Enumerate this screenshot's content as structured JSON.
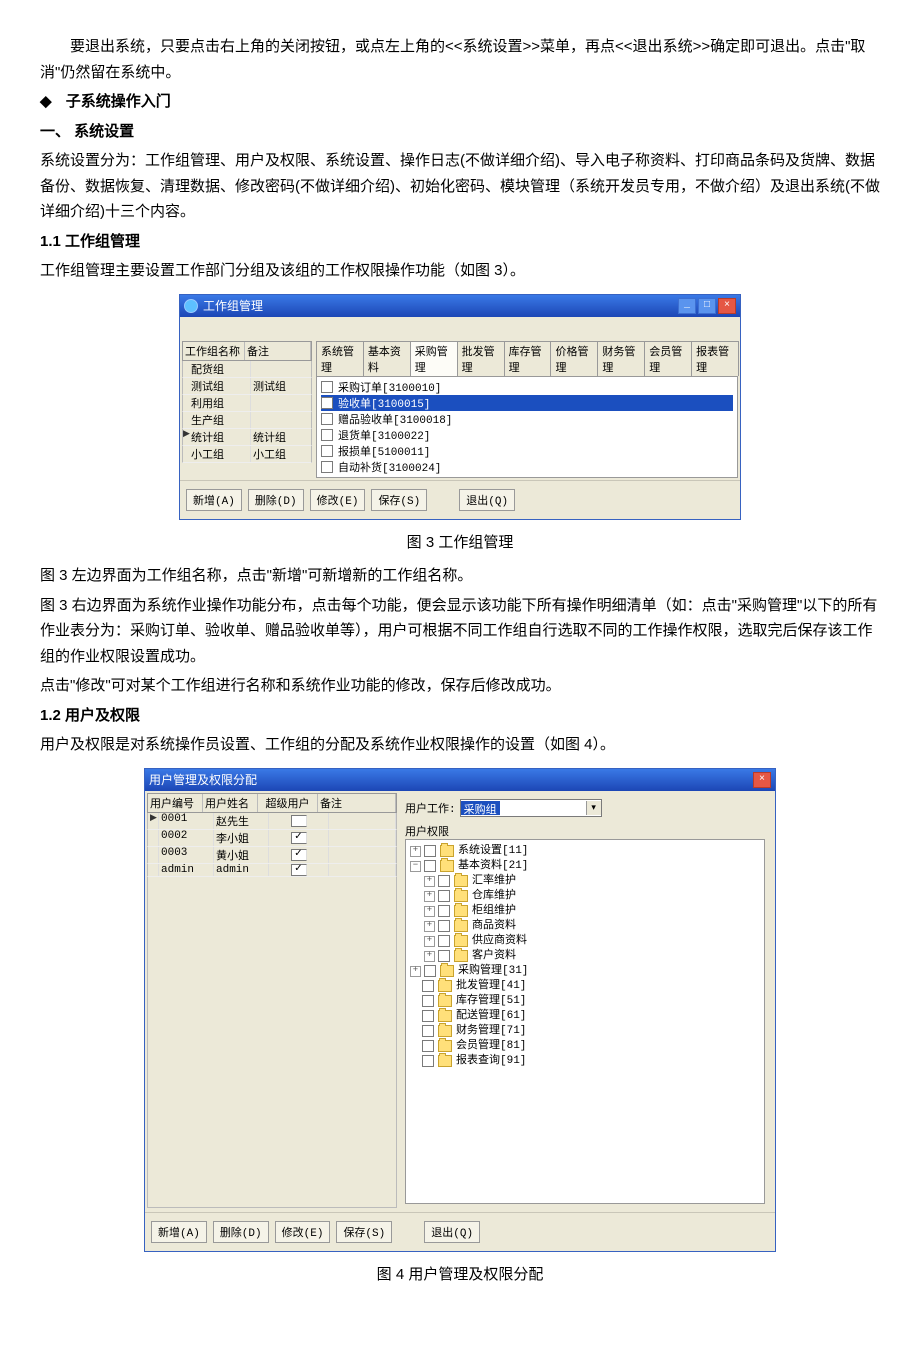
{
  "text": {
    "para1": "要退出系统，只要点击右上角的关闭按钮，或点左上角的<<系统设置>>菜单，再点<<退出系统>>确定即可退出。点击\"取消\"仍然留在系统中。",
    "bullet1": "子系统操作入门",
    "h1": "一、 系统设置",
    "para2": "系统设置分为：工作组管理、用户及权限、系统设置、操作日志(不做详细介绍)、导入电子称资料、打印商品条码及货牌、数据备份、数据恢复、清理数据、修改密码(不做详细介绍)、初始化密码、模块管理（系统开发员专用，不做介绍）及退出系统(不做详细介绍)十三个内容。",
    "h11": "1.1 工作组管理",
    "para3": "工作组管理主要设置工作部门分组及该组的工作权限操作功能（如图 3）。",
    "caption3": "图 3  工作组管理",
    "para4": "图 3 左边界面为工作组名称，点击\"新增\"可新增新的工作组名称。",
    "para5": "图 3 右边界面为系统作业操作功能分布，点击每个功能，便会显示该功能下所有操作明细清单（如：点击\"采购管理\"以下的所有作业表分为：采购订单、验收单、赠品验收单等），用户可根据不同工作组自行选取不同的工作操作权限，选取完后保存该工作组的作业权限设置成功。",
    "para6": "点击\"修改\"可对某个工作组进行名称和系统作业功能的修改，保存后修改成功。",
    "h12": "1.2 用户及权限",
    "para7": "用户及权限是对系统操作员设置、工作组的分配及系统作业权限操作的设置（如图 4）。",
    "caption4": "图 4  用户管理及权限分配"
  },
  "win3": {
    "title": "工作组管理",
    "winbtns": {
      "min": "_",
      "max": "□",
      "close": "×"
    },
    "cols": {
      "c1": "工作组名称",
      "c2": "备注"
    },
    "rows": [
      {
        "mark": "",
        "name": "配货组",
        "remark": ""
      },
      {
        "mark": "",
        "name": "测试组",
        "remark": "测试组"
      },
      {
        "mark": "",
        "name": "利用组",
        "remark": ""
      },
      {
        "mark": "",
        "name": "生产组",
        "remark": ""
      },
      {
        "mark": "▶",
        "name": "统计组",
        "remark": "统计组"
      },
      {
        "mark": "",
        "name": "小工组",
        "remark": "小工组"
      }
    ],
    "tabs": [
      "系统管理",
      "基本资料",
      "采购管理",
      "批发管理",
      "库存管理",
      "价格管理",
      "财务管理",
      "会员管理",
      "报表管理"
    ],
    "activeTab": 2,
    "items": [
      {
        "label": "采购订单[3100010]",
        "sel": false
      },
      {
        "label": "验收单[3100015]",
        "sel": true
      },
      {
        "label": "赠品验收单[3100018]",
        "sel": false
      },
      {
        "label": "退货单[3100022]",
        "sel": false
      },
      {
        "label": "报损单[5100011]",
        "sel": false
      },
      {
        "label": "自动补货[3100024]",
        "sel": false
      }
    ],
    "buttons": {
      "add": "新增(A)",
      "del": "删除(D)",
      "edit": "修改(E)",
      "save": "保存(S)",
      "exit": "退出(Q)"
    }
  },
  "win4": {
    "title": "用户管理及权限分配",
    "close": "×",
    "cols": {
      "c1": "用户编号",
      "c2": "用户姓名",
      "c3": "超级用户",
      "c4": "备注"
    },
    "rows": [
      {
        "mark": "▶",
        "id": "0001",
        "name": "赵先生",
        "super": false
      },
      {
        "mark": "",
        "id": "0002",
        "name": "李小姐",
        "super": true
      },
      {
        "mark": "",
        "id": "0003",
        "name": "黄小姐",
        "super": true
      },
      {
        "mark": "",
        "id": "admin",
        "name": "admin",
        "super": true
      }
    ],
    "groupLabel": "用户工作:",
    "groupValue": "采购组",
    "panelTitle": "用户权限",
    "tree": [
      {
        "toggle": "+",
        "label": "系统设置[11]"
      },
      {
        "toggle": "−",
        "label": "基本资料[21]",
        "children": [
          {
            "toggle": "+",
            "label": "汇率维护"
          },
          {
            "toggle": "+",
            "label": "仓库维护"
          },
          {
            "toggle": "+",
            "label": "柜组维护"
          },
          {
            "toggle": "+",
            "label": "商品资料"
          },
          {
            "toggle": "+",
            "label": "供应商资料"
          },
          {
            "toggle": "+",
            "label": "客户资料"
          }
        ]
      },
      {
        "toggle": "+",
        "label": "采购管理[31]"
      },
      {
        "toggle": "",
        "label": "批发管理[41]"
      },
      {
        "toggle": "",
        "label": "库存管理[51]"
      },
      {
        "toggle": "",
        "label": "配送管理[61]"
      },
      {
        "toggle": "",
        "label": "财务管理[71]"
      },
      {
        "toggle": "",
        "label": "会员管理[81]"
      },
      {
        "toggle": "",
        "label": "报表查询[91]"
      }
    ],
    "buttons": {
      "add": "新增(A)",
      "del": "删除(D)",
      "edit": "修改(E)",
      "save": "保存(S)",
      "exit": "退出(Q)"
    }
  }
}
